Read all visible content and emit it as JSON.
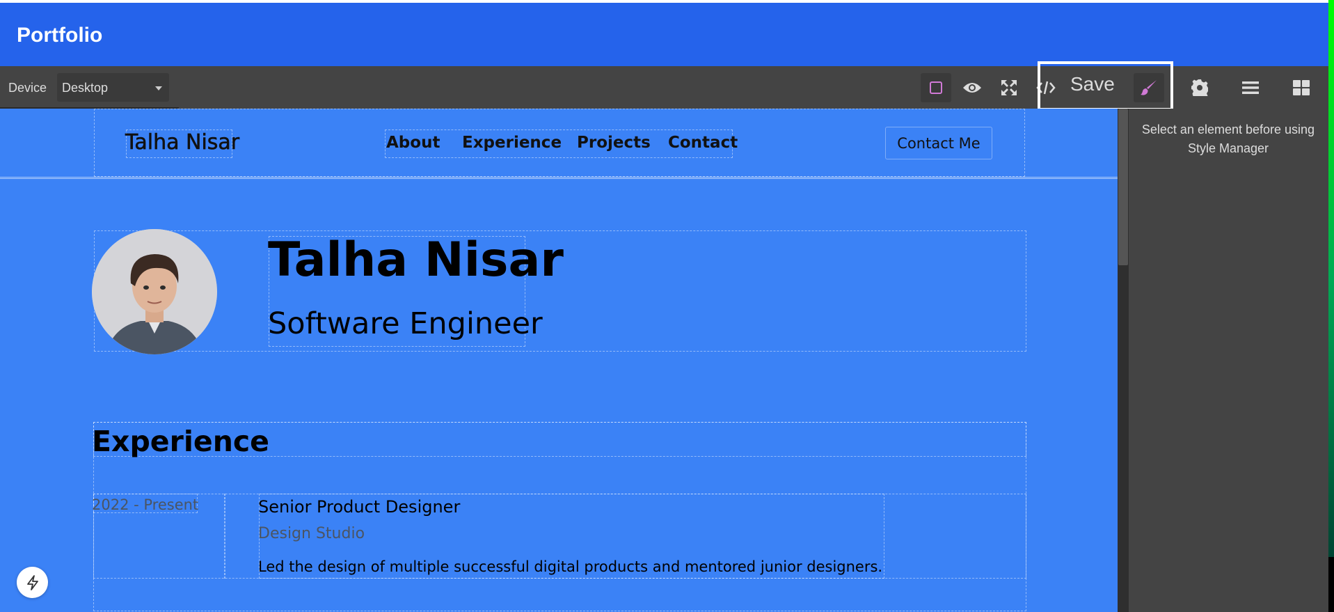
{
  "app": {
    "title": "Portfolio"
  },
  "toolbar": {
    "device_label": "Device",
    "device_value": "Desktop",
    "save_label": "Save",
    "icons": [
      "square-outline-icon",
      "eye-icon",
      "fullscreen-icon",
      "code-icon",
      "paint-brush-icon",
      "gear-icon",
      "layers-icon",
      "blocks-icon"
    ]
  },
  "site": {
    "brand": "Talha Nisar",
    "nav": [
      "About",
      "Experience",
      "Projects",
      "Contact"
    ],
    "cta": "Contact Me",
    "hero": {
      "name": "Talha Nisar",
      "role": "Software Engineer"
    },
    "experience": {
      "title": "Experience",
      "items": [
        {
          "date": "2022 - Present",
          "title": "Senior Product Designer",
          "company": "Design Studio",
          "description": "Led the design of multiple successful digital products and mentored junior designers."
        }
      ]
    }
  },
  "panel": {
    "style_manager_message": "Select an element before using Style Manager"
  },
  "colors": {
    "header": "#2563eb",
    "canvas": "#3b82f6",
    "toolbar": "#444444",
    "brush": "#d17ad6"
  }
}
